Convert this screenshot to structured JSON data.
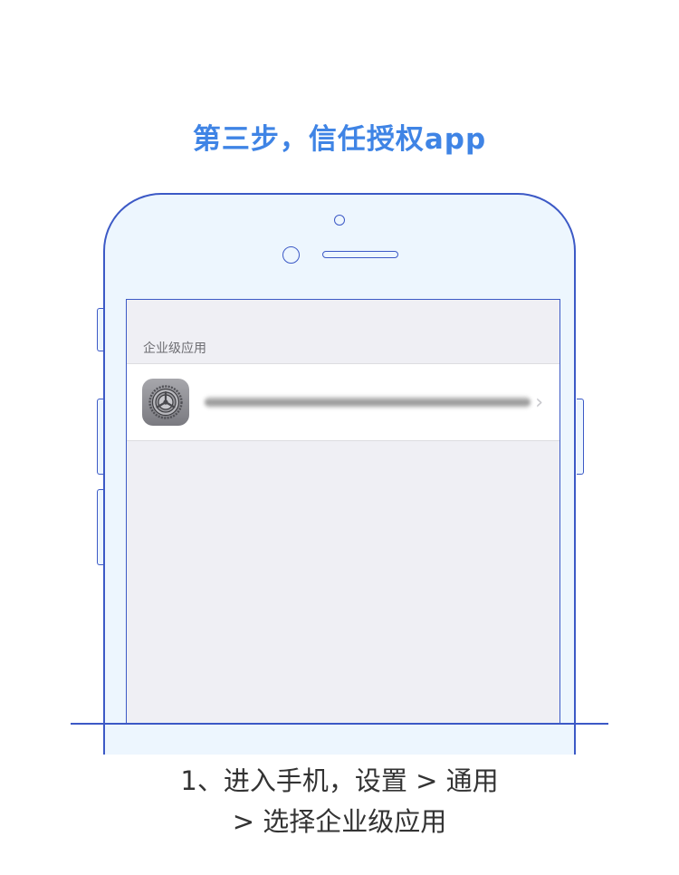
{
  "title": "第三步，信任授权app",
  "screen": {
    "section_header": "企业级应用",
    "cell": {
      "icon": "settings-gear-icon",
      "chevron": "›"
    }
  },
  "instructions": {
    "line1": "1、进入手机，设置 > 通用",
    "line2": "> 选择企业级应用"
  },
  "colors": {
    "accent": "#3f84e5",
    "outline": "#3c59c6",
    "phone_fill": "#edf6fe",
    "screen_bg": "#efeff4"
  }
}
